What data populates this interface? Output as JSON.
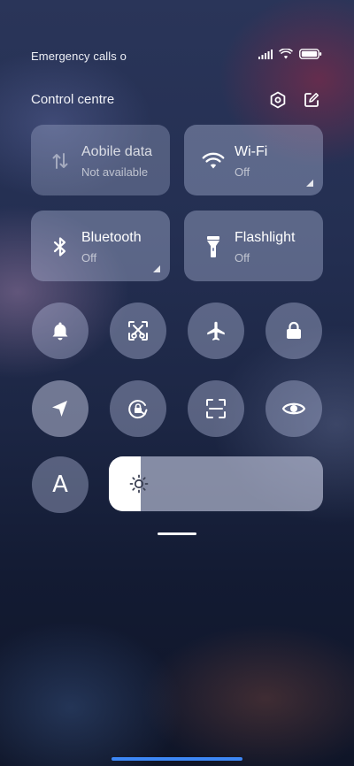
{
  "status_bar": {
    "carrier_text": "Emergency calls o",
    "icons": [
      "signal-icon",
      "wifi-icon",
      "battery-icon"
    ]
  },
  "header": {
    "title": "Control centre",
    "buttons": [
      "settings-icon",
      "edit-icon"
    ]
  },
  "tiles": [
    {
      "name": "Mobile data",
      "display_name": "Aobile data",
      "state": "Not available",
      "icon": "mobile-data-icon",
      "expandable": false
    },
    {
      "name": "Wi-Fi",
      "state": "Off",
      "icon": "wifi-icon",
      "expandable": true
    },
    {
      "name": "Bluetooth",
      "state": "Off",
      "icon": "bluetooth-icon",
      "expandable": true
    },
    {
      "name": "Flashlight",
      "state": "Off",
      "icon": "flashlight-icon",
      "expandable": false
    }
  ],
  "toggles_row1": [
    {
      "name": "Ringer",
      "icon": "bell-icon"
    },
    {
      "name": "Screenshot",
      "icon": "scissors-screenshot-icon"
    },
    {
      "name": "Airplane mode",
      "icon": "airplane-icon"
    },
    {
      "name": "Lock screen",
      "icon": "lock-icon"
    }
  ],
  "toggles_row2": [
    {
      "name": "Location",
      "icon": "location-icon"
    },
    {
      "name": "Auto-rotate",
      "icon": "rotation-lock-icon"
    },
    {
      "name": "Scanner",
      "icon": "scan-icon"
    },
    {
      "name": "Reading mode",
      "icon": "eye-icon"
    }
  ],
  "auto_brightness": {
    "label": "A",
    "icon": "auto-brightness-icon"
  },
  "brightness": {
    "level_percent": 15,
    "icon": "sun-icon"
  },
  "colors": {
    "accent_nav": "#3d87f5",
    "tile_bg": "rgba(185,195,225,0.38)"
  }
}
